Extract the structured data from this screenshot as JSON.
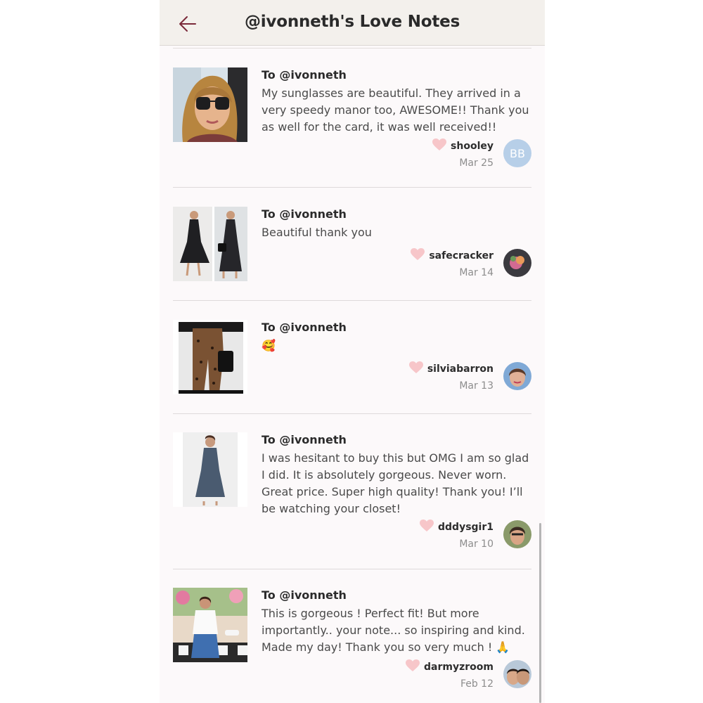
{
  "header": {
    "back_icon": "back-arrow-icon",
    "title": "@ivonneth's Love Notes"
  },
  "colors": {
    "accent": "#7a2a3a",
    "heart": "#f7c6c9",
    "avatar_bb": "#b7cfe8"
  },
  "notes": [
    {
      "to": "To @ivonneth",
      "message": "My sunglasses are beautiful. They arrived in a very speedy manor too, AWESOME!! Thank you as well for the card, it was well received!!",
      "username": "shooley",
      "date": "Mar 25",
      "avatar_initials": "BB"
    },
    {
      "to": "To @ivonneth",
      "message": "Beautiful thank you",
      "username": "safecracker",
      "date": "Mar 14"
    },
    {
      "to": "To @ivonneth",
      "message": "🥰",
      "username": "silviabarron",
      "date": "Mar 13"
    },
    {
      "to": "To @ivonneth",
      "message": "I was hesitant to buy this but OMG I am so glad I did. It is absolutely gorgeous. Never worn. Great price. Super high quality! Thank you! I’ll be watching your closet!",
      "username": "dddysgir1",
      "date": "Mar 10"
    },
    {
      "to": "To @ivonneth",
      "message": "This is gorgeous ! Perfect fit! But more importantly.. your note... so inspiring and kind. Made my day! Thank you so very much ! 🙏",
      "username": "darmyzroom",
      "date": "Feb 12"
    }
  ]
}
